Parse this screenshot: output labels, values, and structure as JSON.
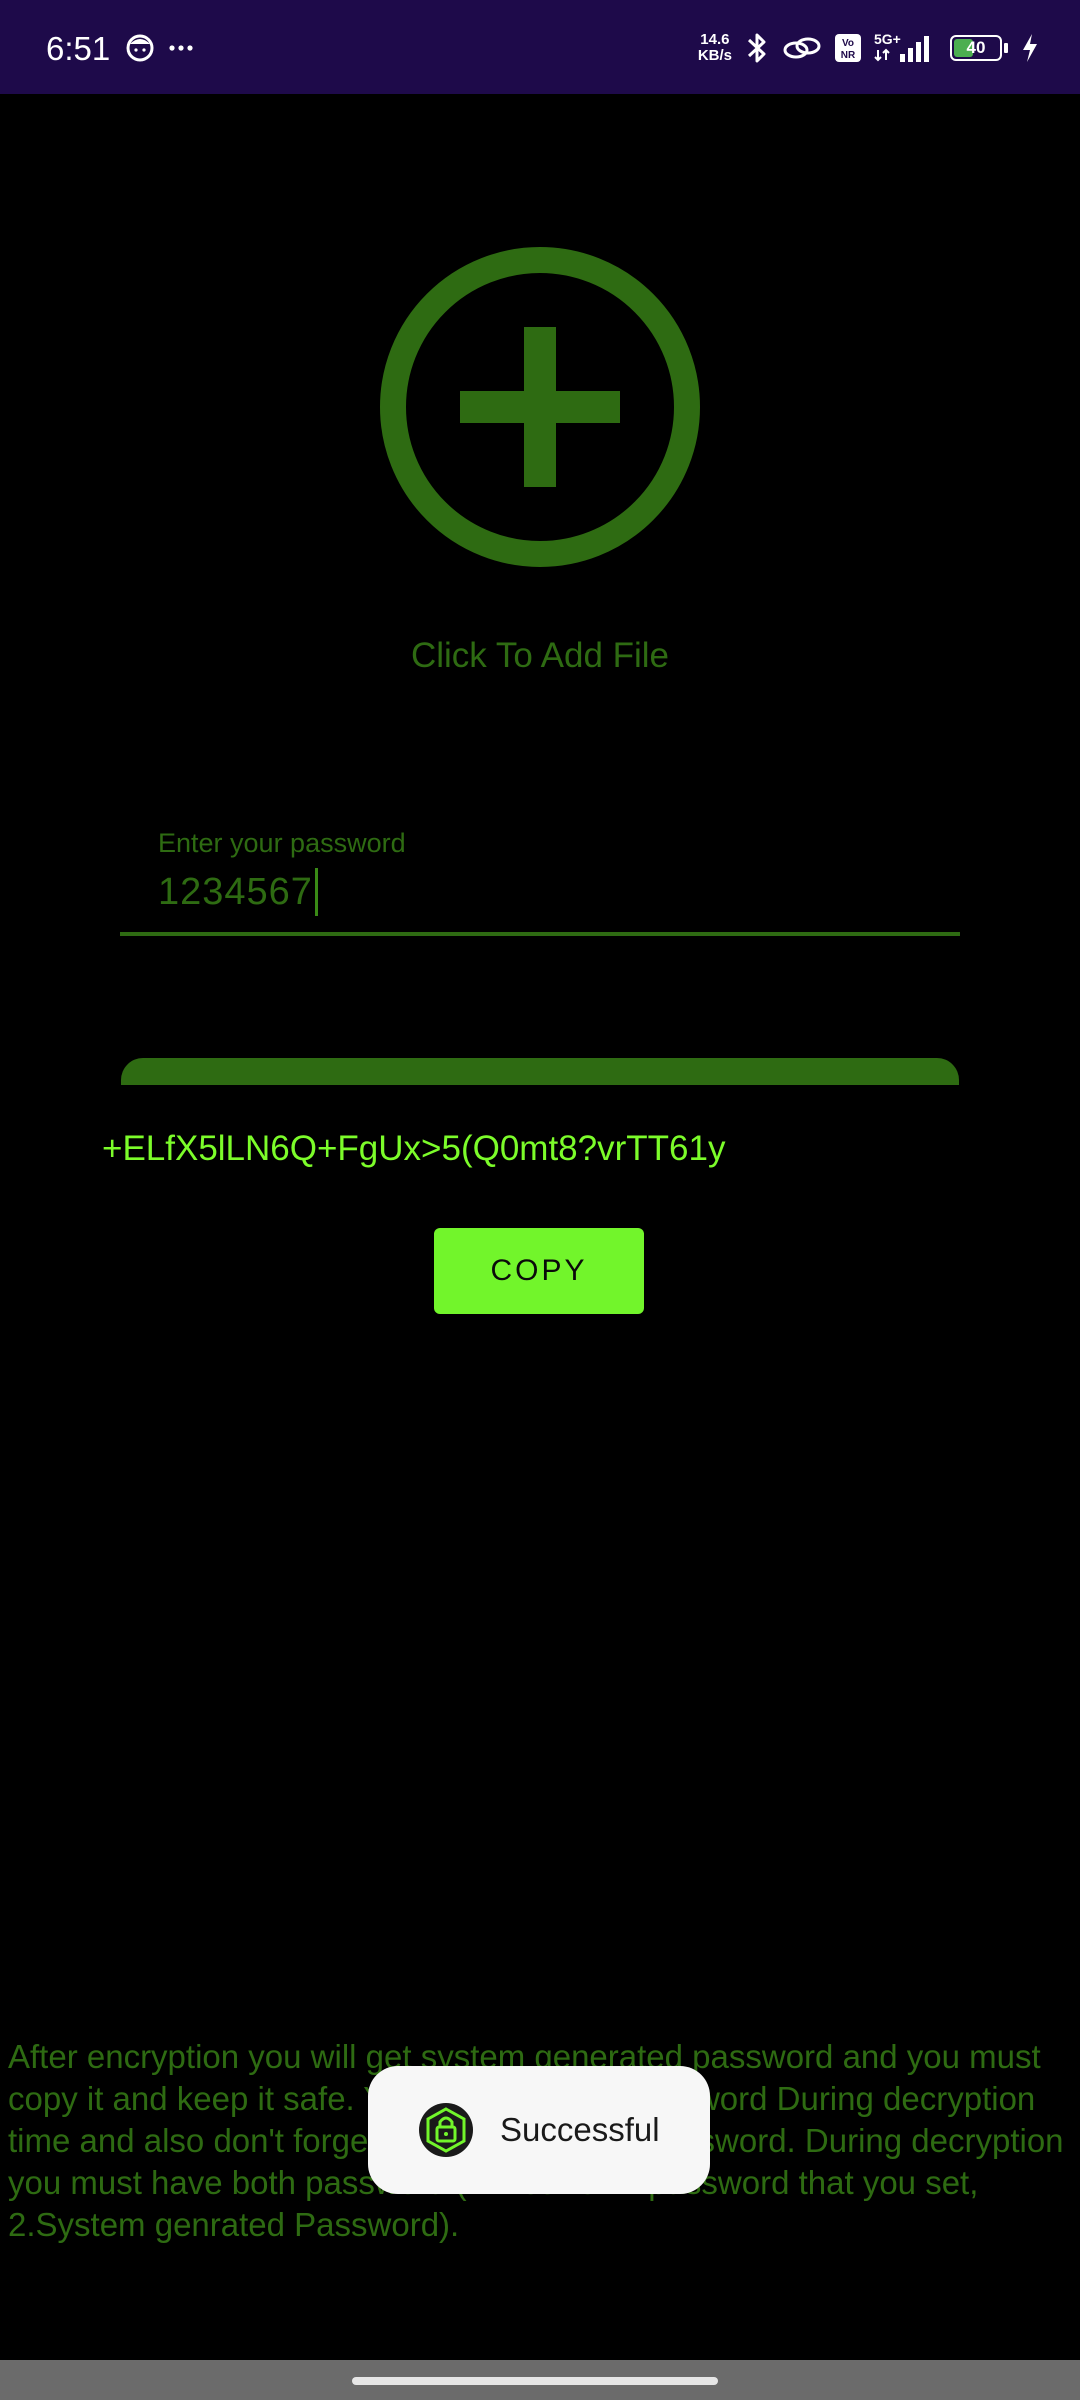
{
  "status_bar": {
    "time": "6:51",
    "network_speed_value": "14.6",
    "network_speed_unit": "KB/s",
    "battery_level": "40",
    "icons": [
      "face-icon",
      "more-dots-icon",
      "bluetooth-icon",
      "link-icon",
      "volte-icon",
      "5g-signal-icon",
      "signal-bars-icon",
      "battery-icon",
      "charging-bolt-icon"
    ]
  },
  "main": {
    "add_file_label": "Click To Add File",
    "password_field": {
      "label": "Enter your password",
      "value": "1234567"
    }
  },
  "dialog": {
    "generated_password": "+ELfX5lLN6Q+FgUx>5(Q0mt8?vrTT61y",
    "copy_label": "COPY"
  },
  "info_text": "After encryption you will get system generated password and you must copy it and keep it safe. You will need this password During decryption time and also don't forget to save your own password. During decryption you must have both password (1. Your own password that you set, 2.System genrated Password).",
  "toast": {
    "text": "Successful",
    "icon": "lock-icon"
  },
  "colors": {
    "accent": "#2e6b12",
    "bright_accent": "#72f52b",
    "status_bar": "#1e0a4a",
    "background": "#000000"
  }
}
